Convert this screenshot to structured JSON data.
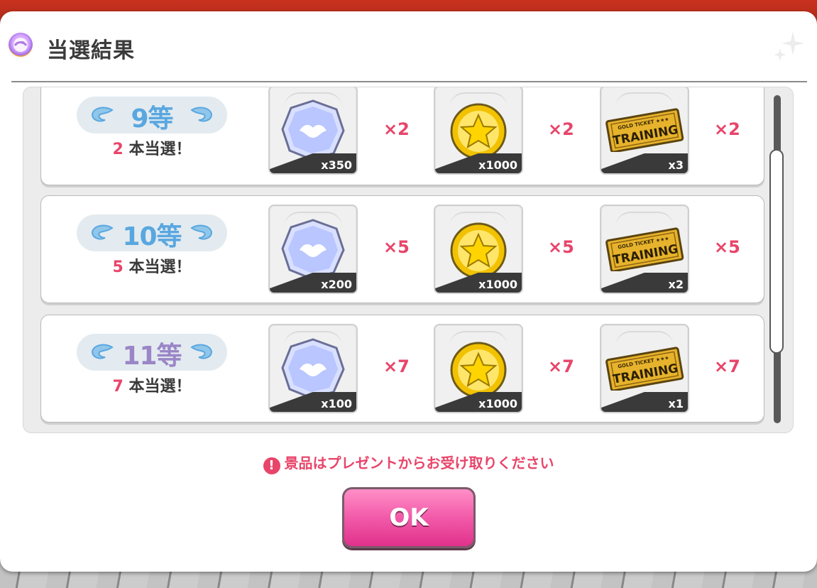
{
  "dialog": {
    "title": "当選結果",
    "icon": "gacha-capsule-icon"
  },
  "prizes": [
    {
      "rank_number": "9",
      "rank_suffix": "等",
      "rank_color": "#5aa7e0",
      "winners_count": "2",
      "winners_label": "本当選！",
      "items": [
        {
          "icon": "star-jewel-icon",
          "qty": "x350",
          "mult": "×2"
        },
        {
          "icon": "star-coin-icon",
          "qty": "x1000",
          "mult": "×2"
        },
        {
          "icon": "gold-training-ticket-icon",
          "qty": "x3",
          "mult": "×2",
          "ticket_top": "GOLD TICKET ★★★",
          "ticket_text": "TRAINING"
        }
      ]
    },
    {
      "rank_number": "10",
      "rank_suffix": "等",
      "rank_color": "#5aa7e0",
      "winners_count": "5",
      "winners_label": "本当選！",
      "items": [
        {
          "icon": "star-jewel-icon",
          "qty": "x200",
          "mult": "×5"
        },
        {
          "icon": "star-coin-icon",
          "qty": "x1000",
          "mult": "×5"
        },
        {
          "icon": "gold-training-ticket-icon",
          "qty": "x2",
          "mult": "×5",
          "ticket_top": "GOLD TICKET ★★★",
          "ticket_text": "TRAINING"
        }
      ]
    },
    {
      "rank_number": "11",
      "rank_suffix": "等",
      "rank_color": "#9a86c6",
      "winners_count": "7",
      "winners_label": "本当選！",
      "items": [
        {
          "icon": "star-jewel-icon",
          "qty": "x100",
          "mult": "×7"
        },
        {
          "icon": "star-coin-icon",
          "qty": "x1000",
          "mult": "×7"
        },
        {
          "icon": "gold-training-ticket-icon",
          "qty": "x1",
          "mult": "×7",
          "ticket_top": "GOLD TICKET ★★★",
          "ticket_text": "TRAINING"
        }
      ]
    }
  ],
  "notice": "景品はプレゼントからお受け取りください",
  "ok_button": "OK",
  "colors": {
    "accent_pink": "#e8456a",
    "ok_button": "#f25aa9"
  }
}
